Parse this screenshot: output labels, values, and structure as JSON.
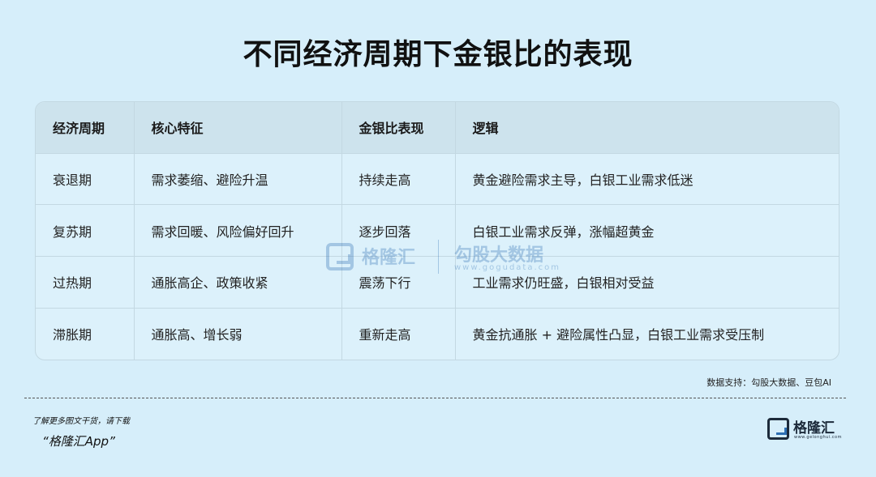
{
  "title": "不同经济周期下金银比的表现",
  "table": {
    "headers": [
      "经济周期",
      "核心特征",
      "金银比表现",
      "逻辑"
    ],
    "rows": [
      [
        "衰退期",
        "需求萎缩、避险升温",
        "持续走高",
        "黄金避险需求主导，白银工业需求低迷"
      ],
      [
        "复苏期",
        "需求回暖、风险偏好回升",
        "逐步回落",
        "白银工业需求反弹，涨幅超黄金"
      ],
      [
        "过热期",
        "通胀高企、政策收紧",
        "震荡下行",
        "工业需求仍旺盛，白银相对受益"
      ],
      [
        "滞胀期",
        "通胀高、增长弱",
        "重新走高",
        "黄金抗通胀 + 避险属性凸显，白银工业需求受压制"
      ]
    ]
  },
  "watermark": {
    "name": "格隆汇",
    "name2": "勾股大数据",
    "url": "www.gogudata.com"
  },
  "source": "数据支持：勾股大数据、豆包AI",
  "footer": {
    "note": "了解更多图文干货，请下载",
    "app": "“格隆汇App”"
  },
  "brand": {
    "name": "格隆汇",
    "url": "www.gelonghui.com"
  },
  "colors": {
    "background": "#d6eefa",
    "header_row": "#cde3ed",
    "brand_blue": "#2d6fb2"
  }
}
